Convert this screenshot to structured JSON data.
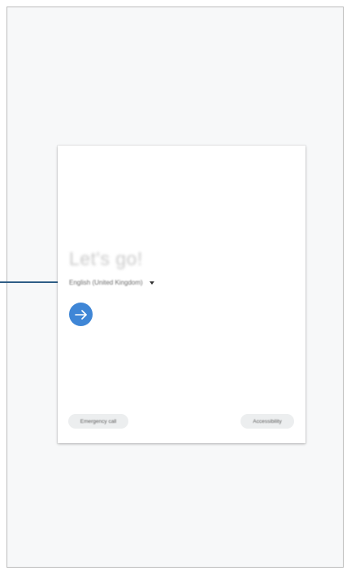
{
  "setup_screen": {
    "title": "Let's go!",
    "language": {
      "selected": "English (United Kingdom)",
      "dropdown_icon": "caret-down-icon"
    },
    "next_button": {
      "icon": "arrow-right-icon"
    },
    "buttons": {
      "emergency_call": "Emergency call",
      "accessibility": "Accessibility"
    }
  },
  "colors": {
    "next_button": "#3f86d6",
    "callout_line": "#2f5e86",
    "panel_background": "#f7f8f9"
  }
}
